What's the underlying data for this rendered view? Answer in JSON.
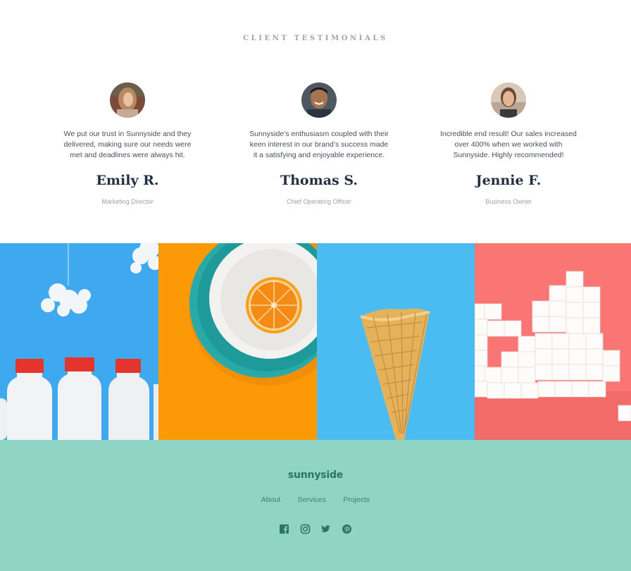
{
  "testimonials": {
    "title": "CLIENT TESTIMONIALS",
    "items": [
      {
        "quote": "We put our trust in Sunnyside and they delivered, making sure our needs were met and deadlines were always hit.",
        "name": "Emily R.",
        "role": "Marketing Director"
      },
      {
        "quote": "Sunnyside’s enthusiasm coupled with their keen interest in our brand’s success made it a satisfying and enjoyable experience.",
        "name": "Thomas S.",
        "role": "Chief Operating Officer"
      },
      {
        "quote": "Incredible end result! Our sales increased over 400% when we worked with Sunnyside. Highly recommended!",
        "name": "Jennie F.",
        "role": "Business Owner"
      }
    ]
  },
  "gallery": {
    "images": [
      "milk-bottles-image",
      "orange-plate-image",
      "ice-cream-cone-image",
      "sugar-cubes-image"
    ]
  },
  "footer": {
    "logo": "sunnyside",
    "nav": [
      "About",
      "Services",
      "Projects"
    ],
    "social_icons": [
      "facebook-icon",
      "instagram-icon",
      "twitter-icon",
      "pinterest-icon"
    ]
  },
  "colors": {
    "footer_bg": "#90d4c5",
    "footer_text": "#2c7566",
    "heading": "#24303f"
  }
}
